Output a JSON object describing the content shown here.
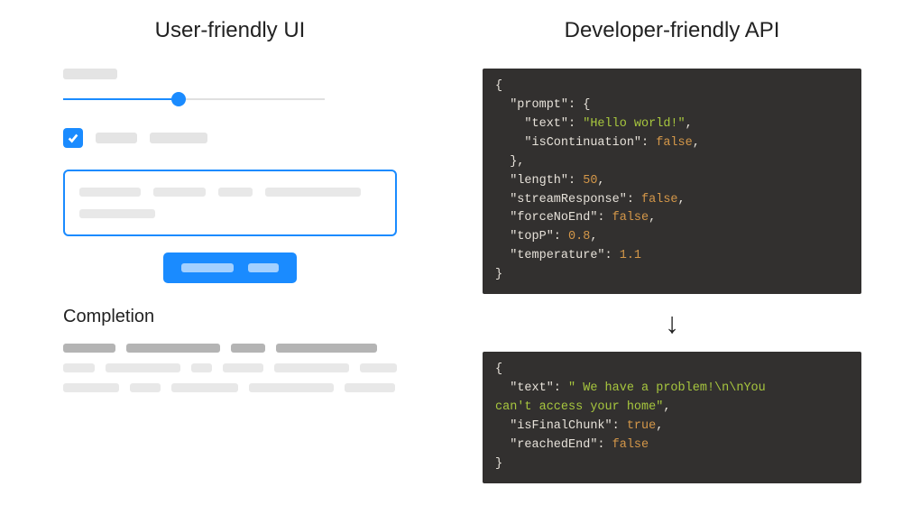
{
  "left": {
    "title": "User-friendly UI",
    "completion_title": "Completion"
  },
  "right": {
    "title": "Developer-friendly API",
    "request": {
      "prompt": {
        "text": "Hello world!",
        "isContinuation": false
      },
      "length": 50,
      "streamResponse": false,
      "forceNoEnd": false,
      "topP": 0.8,
      "temperature": 1.1
    },
    "response": {
      "text": " We have a problem!\\n\\nYou can't access your home",
      "isFinalChunk": true,
      "reachedEnd": false
    },
    "request_display": {
      "l1": "{",
      "l2": "  \"prompt\": {",
      "l3a": "    \"text\": ",
      "l3b": "\"Hello world!\"",
      "l3c": ",",
      "l4a": "    \"isContinuation\": ",
      "l4b": "false",
      "l4c": ",",
      "l5": "  },",
      "l6a": "  \"length\": ",
      "l6b": "50",
      "l6c": ",",
      "l7a": "  \"streamResponse\": ",
      "l7b": "false",
      "l7c": ",",
      "l8a": "  \"forceNoEnd\": ",
      "l8b": "false",
      "l8c": ",",
      "l9a": "  \"topP\": ",
      "l9b": "0.8",
      "l9c": ",",
      "l10a": "  \"temperature\": ",
      "l10b": "1.1",
      "l11": "}"
    },
    "response_display": {
      "l1": "{",
      "l2a": "  \"text\": ",
      "l2b": "\" We have a problem!\\n\\nYou ",
      "l3b": "can't access your home\"",
      "l3c": ",",
      "l4a": "  \"isFinalChunk\": ",
      "l4b": "true",
      "l4c": ",",
      "l5a": "  \"reachedEnd\": ",
      "l5b": "false",
      "l6": "}"
    },
    "arrow": "↓"
  }
}
